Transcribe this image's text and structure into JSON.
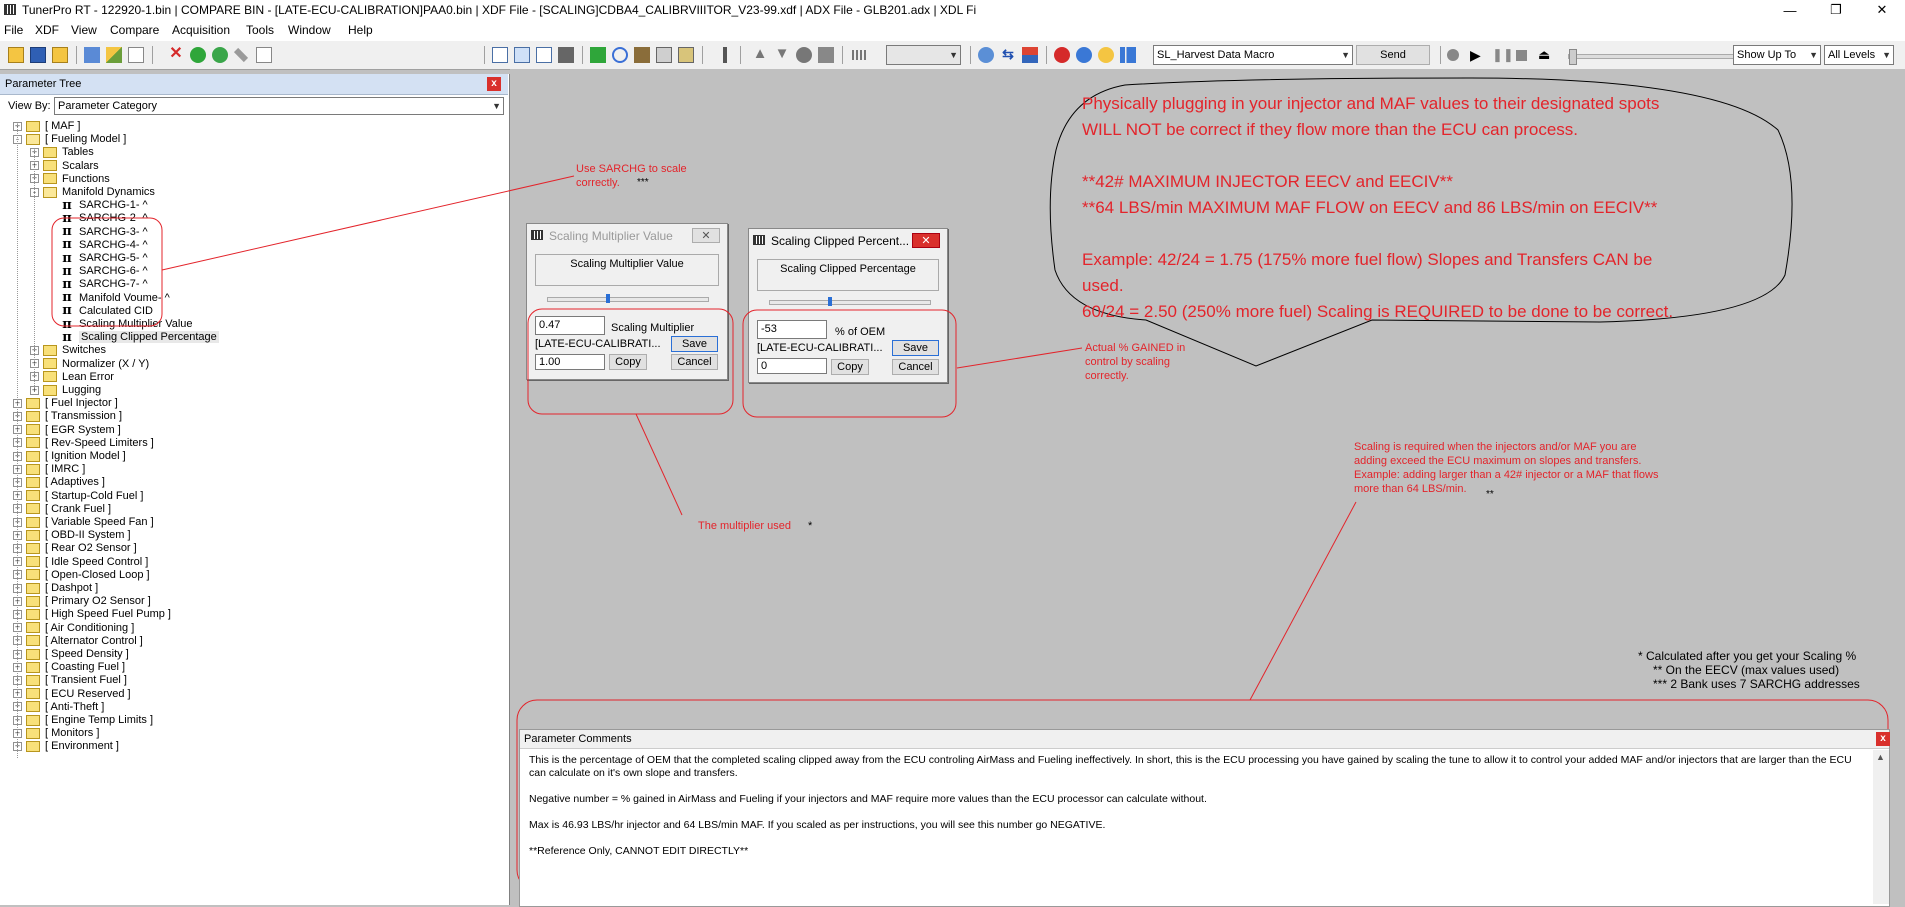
{
  "window": {
    "title": "TunerPro RT - 122920-1.bin | COMPARE BIN - [LATE-ECU-CALIBRATION]PAA0.bin | XDF File - [SCALING]CDBA4_CALIBRVIIITOR_V23-99.xdf | ADX File - GLB201.adx | XDL Fi",
    "min_glyph": "—",
    "restore_glyph": "❐",
    "close_glyph": "✕"
  },
  "menu": [
    "File",
    "XDF",
    "View",
    "Compare",
    "Acquisition",
    "Tools",
    "Window",
    "Help"
  ],
  "toolbar": {
    "macro_select": "SL_Harvest Data Macro",
    "send_label": "Send",
    "show_select": "Show Up To",
    "levels_select": "All Levels",
    "icons": [
      "open-icon",
      "save-icon",
      "open-folder-icon",
      "chart-icon",
      "edit-icon",
      "new-icon",
      "delete-icon",
      "add-icon",
      "refresh-icon",
      "tools-icon",
      "blank-icon",
      "view1-icon",
      "view2-icon",
      "view3-icon",
      "view4-icon",
      "grid-icon",
      "search-icon",
      "compare-icon",
      "table-icon",
      "calc-icon",
      "wand-icon",
      "up-icon",
      "down-icon",
      "circle-icon",
      "copy-icon",
      "chip-icon",
      "link-icon",
      "swap-icon",
      "flag-icon",
      "stop-red-icon",
      "globe-icon",
      "star-icon",
      "bars-icon",
      "record-icon",
      "play-icon",
      "pause-icon",
      "stop-icon",
      "eject-icon"
    ]
  },
  "param_tree": {
    "title": "Parameter Tree",
    "viewby_label": "View By:",
    "viewby_value": "Parameter Category",
    "items": [
      {
        "label": "[ MAF ]",
        "level": 0,
        "kind": "folder",
        "exp": "+"
      },
      {
        "label": "[ Fueling Model ]",
        "level": 0,
        "kind": "folder-open",
        "exp": "-"
      },
      {
        "label": "Tables",
        "level": 1,
        "kind": "folder",
        "exp": "+"
      },
      {
        "label": "Scalars",
        "level": 1,
        "kind": "folder",
        "exp": "+"
      },
      {
        "label": "Functions",
        "level": 1,
        "kind": "folder",
        "exp": "+"
      },
      {
        "label": "Manifold Dynamics",
        "level": 1,
        "kind": "folder-open",
        "exp": "-"
      },
      {
        "label": "SARCHG-1- ^",
        "level": 2,
        "kind": "pi",
        "exp": ""
      },
      {
        "label": "SARCHG-2- ^",
        "level": 2,
        "kind": "pi",
        "exp": ""
      },
      {
        "label": "SARCHG-3- ^",
        "level": 2,
        "kind": "pi",
        "exp": ""
      },
      {
        "label": "SARCHG-4- ^",
        "level": 2,
        "kind": "pi",
        "exp": ""
      },
      {
        "label": "SARCHG-5- ^",
        "level": 2,
        "kind": "pi",
        "exp": ""
      },
      {
        "label": "SARCHG-6- ^",
        "level": 2,
        "kind": "pi",
        "exp": ""
      },
      {
        "label": "SARCHG-7- ^",
        "level": 2,
        "kind": "pi",
        "exp": ""
      },
      {
        "label": "Manifold Voume- ^",
        "level": 2,
        "kind": "pi",
        "exp": ""
      },
      {
        "label": "Calculated CID",
        "level": 2,
        "kind": "pi",
        "exp": ""
      },
      {
        "label": "Scaling Multiplier Value",
        "level": 2,
        "kind": "pi",
        "exp": ""
      },
      {
        "label": "Scaling Clipped Percentage",
        "level": 2,
        "kind": "pi",
        "exp": "",
        "selected": true
      },
      {
        "label": "Switches",
        "level": 1,
        "kind": "folder",
        "exp": "+"
      },
      {
        "label": "Normalizer (X / Y)",
        "level": 1,
        "kind": "folder",
        "exp": "+"
      },
      {
        "label": "Lean Error",
        "level": 1,
        "kind": "folder",
        "exp": "+"
      },
      {
        "label": "Lugging",
        "level": 1,
        "kind": "folder",
        "exp": "+"
      },
      {
        "label": "[ Fuel Injector ]",
        "level": 0,
        "kind": "folder",
        "exp": "+"
      },
      {
        "label": "[ Transmission ]",
        "level": 0,
        "kind": "folder",
        "exp": "+"
      },
      {
        "label": "[ EGR System ]",
        "level": 0,
        "kind": "folder",
        "exp": "+"
      },
      {
        "label": "[ Rev-Speed Limiters ]",
        "level": 0,
        "kind": "folder",
        "exp": "+"
      },
      {
        "label": "[ Ignition Model ]",
        "level": 0,
        "kind": "folder",
        "exp": "+"
      },
      {
        "label": "[ IMRC ]",
        "level": 0,
        "kind": "folder",
        "exp": "+"
      },
      {
        "label": "[ Adaptives ]",
        "level": 0,
        "kind": "folder",
        "exp": "+"
      },
      {
        "label": "[ Startup-Cold Fuel ]",
        "level": 0,
        "kind": "folder",
        "exp": "+"
      },
      {
        "label": "[ Crank Fuel ]",
        "level": 0,
        "kind": "folder",
        "exp": "+"
      },
      {
        "label": "[ Variable Speed Fan ]",
        "level": 0,
        "kind": "folder",
        "exp": "+"
      },
      {
        "label": "[ OBD-II System ]",
        "level": 0,
        "kind": "folder",
        "exp": "+"
      },
      {
        "label": "[ Rear O2 Sensor ]",
        "level": 0,
        "kind": "folder",
        "exp": "+"
      },
      {
        "label": "[ Idle Speed Control ]",
        "level": 0,
        "kind": "folder",
        "exp": "+"
      },
      {
        "label": "[ Open-Closed Loop ]",
        "level": 0,
        "kind": "folder",
        "exp": "+"
      },
      {
        "label": "[ Dashpot ]",
        "level": 0,
        "kind": "folder",
        "exp": "+"
      },
      {
        "label": "[ Primary O2 Sensor ]",
        "level": 0,
        "kind": "folder",
        "exp": "+"
      },
      {
        "label": "[ High Speed Fuel Pump ]",
        "level": 0,
        "kind": "folder",
        "exp": "+"
      },
      {
        "label": "[ Air Conditioning ]",
        "level": 0,
        "kind": "folder",
        "exp": "+"
      },
      {
        "label": "[ Alternator Control ]",
        "level": 0,
        "kind": "folder",
        "exp": "+"
      },
      {
        "label": "[ Speed Density ]",
        "level": 0,
        "kind": "folder",
        "exp": "+"
      },
      {
        "label": "[ Coasting Fuel ]",
        "level": 0,
        "kind": "folder",
        "exp": "+"
      },
      {
        "label": "[ Transient Fuel ]",
        "level": 0,
        "kind": "folder",
        "exp": "+"
      },
      {
        "label": "[ ECU Reserved ]",
        "level": 0,
        "kind": "folder",
        "exp": "+"
      },
      {
        "label": "[ Anti-Theft ]",
        "level": 0,
        "kind": "folder",
        "exp": "+"
      },
      {
        "label": "[ Engine Temp Limits ]",
        "level": 0,
        "kind": "folder",
        "exp": "+"
      },
      {
        "label": "[ Monitors ]",
        "level": 0,
        "kind": "folder",
        "exp": "+"
      },
      {
        "label": "[ Environment ]",
        "level": 0,
        "kind": "folder",
        "exp": "+"
      }
    ]
  },
  "dialog1": {
    "title": "Scaling Multiplier Value",
    "header": "Scaling Multiplier Value",
    "value": "0.47",
    "unit": "Scaling Multiplier",
    "source": "[LATE-ECU-CALIBRATI...",
    "compare_value": "1.00",
    "save": "Save",
    "copy": "Copy",
    "cancel": "Cancel",
    "close_glyph": "✕"
  },
  "dialog2": {
    "title": "Scaling Clipped Percent...",
    "header": "Scaling Clipped Percentage",
    "value": "-53",
    "unit": "% of OEM",
    "source": "[LATE-ECU-CALIBRATI...",
    "compare_value": "0",
    "save": "Save",
    "copy": "Copy",
    "cancel": "Cancel",
    "close_glyph": "✕"
  },
  "annotations": {
    "sarchg_note": "Use SARCHG to scale\ncorrectly.",
    "sarchg_stars": "***",
    "multiplier_note": "The multiplier used",
    "multiplier_stars": "*",
    "gained_note": "Actual % GAINED in\ncontrol by scaling\ncorrectly.",
    "bubble": "Physically plugging in your injector and MAF values to their designated spots\nWILL NOT be correct if they flow more than the ECU can process.\n\n**42# MAXIMUM INJECTOR EECV and EECIV**\n**64 LBS/min MAXIMUM MAF FLOW on EECV and 86 LBS/min on EECIV**\n\nExample: 42/24 = 1.75 (175% more fuel flow) Slopes and Transfers CAN be\nused.\n60/24 = 2.50 (250% more fuel) Scaling is REQUIRED to be done to be correct.",
    "scaling_note": "Scaling is required when the injectors and/or MAF you are\nadding exceed the ECU maximum on slopes and transfers.\nExample: adding larger than a 42# injector or a MAF that flows\nmore than 64 LBS/min.",
    "scaling_stars": "**",
    "footnote1": "* Calculated after you get your Scaling %",
    "footnote2": "** On the EECV  (max values used)",
    "footnote3": "*** 2 Bank uses 7 SARCHG addresses"
  },
  "comments": {
    "title": "Parameter Comments",
    "p1": "This is the percentage of OEM that the completed scaling clipped away from the ECU controling AirMass and Fueling ineffectively. In short, this is the ECU processing you have gained by scaling the tune to allow it to control your added MAF and/or injectors that are larger than the ECU can calculate on it's own slope and transfers.",
    "p2": "Negative number = % gained in AirMass and Fueling if your injectors and MAF require more values than the ECU processor can calculate without.",
    "p3": "Max is 46.93 LBS/hr injector and 64 LBS/min MAF. If you scaled as per instructions, you will see this number go NEGATIVE.",
    "p4": "**Reference Only, CANNOT EDIT DIRECTLY**"
  },
  "colors": {
    "annotation": "#e3242b",
    "panel_header": "#d4e1f3",
    "mdi": "#c0c0c0"
  }
}
